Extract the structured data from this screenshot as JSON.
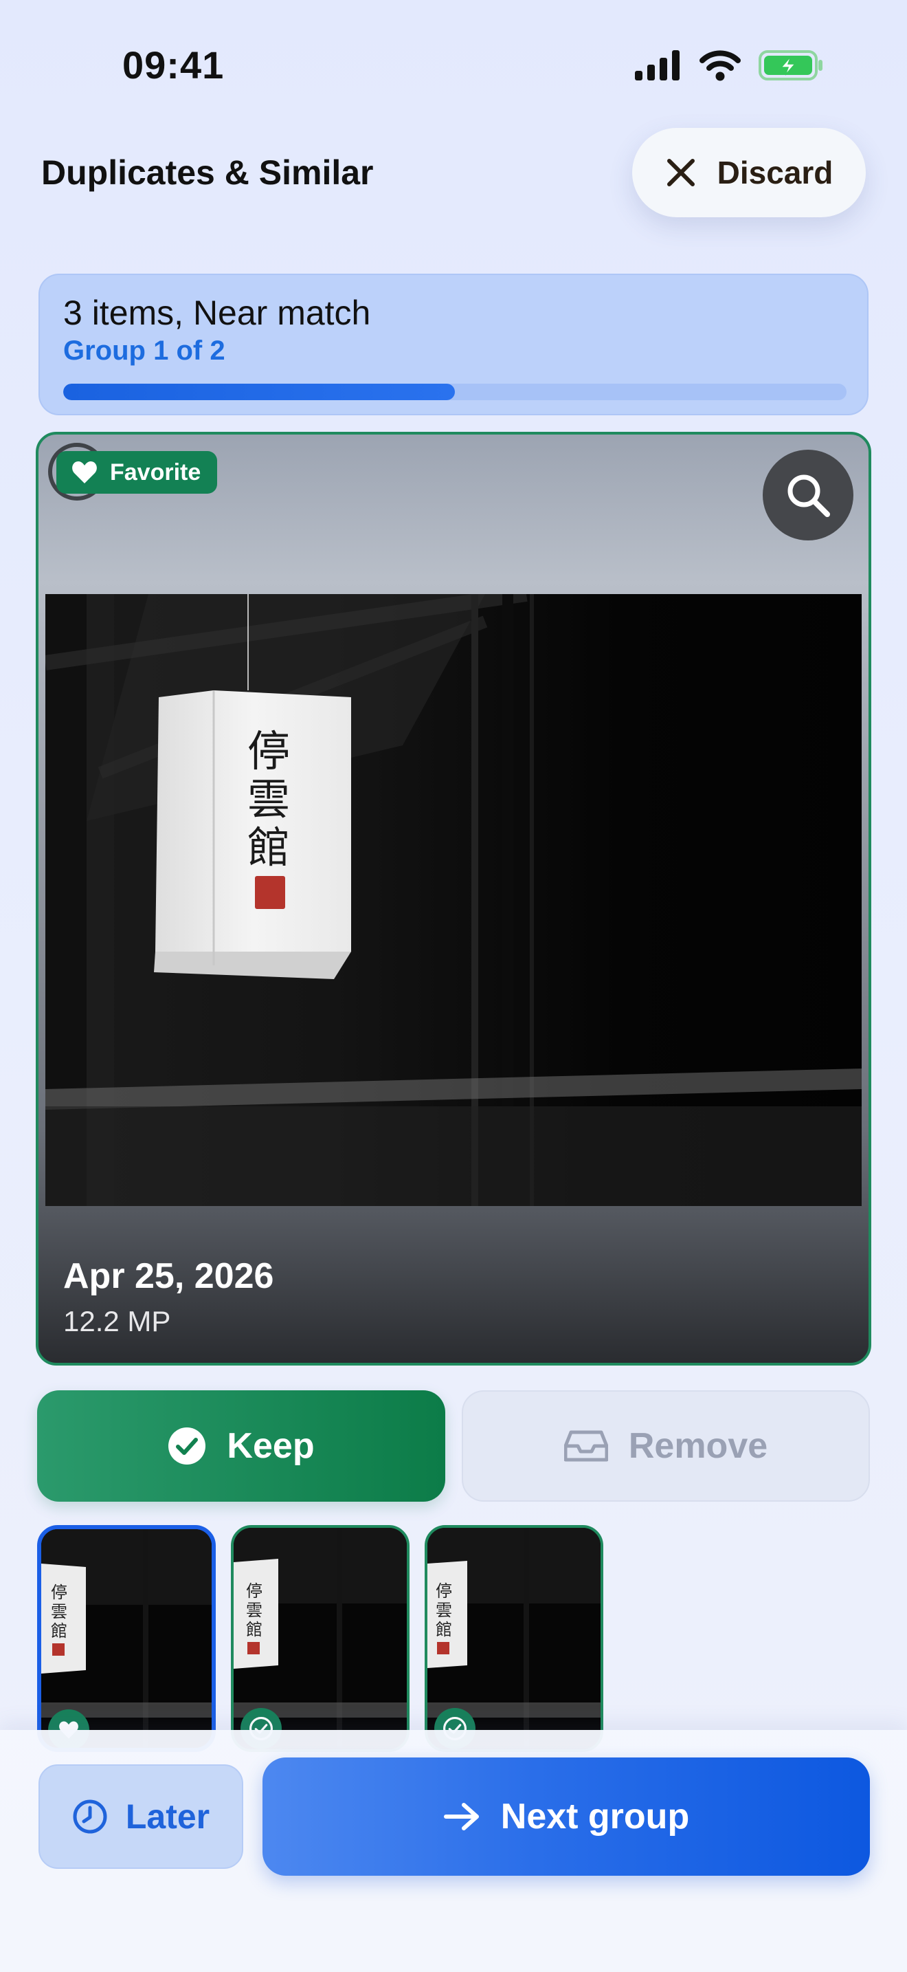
{
  "status_bar": {
    "time": "09:41",
    "icons": [
      "cellular-signal-icon",
      "wifi-icon",
      "battery-charging-icon"
    ],
    "battery_color": "#34c759"
  },
  "header": {
    "title": "Duplicates & Similar",
    "discard_label": "Discard",
    "discard_icon": "close-icon"
  },
  "group": {
    "summary": "3 items, Near match",
    "position_label": "Group 1 of 2",
    "progress_fraction": 0.5
  },
  "photo": {
    "badge_label": "Favorite",
    "badge_icon": "heart-icon",
    "zoom_icon": "search-icon",
    "date": "Apr 25, 2026",
    "resolution": "12.2 MP",
    "border_color": "#1f8a5e"
  },
  "actions": {
    "keep_label": "Keep",
    "keep_icon": "check-circle-icon",
    "remove_label": "Remove",
    "remove_icon": "tray-icon"
  },
  "thumbnails": [
    {
      "selected": true,
      "badge_icon": "heart-icon"
    },
    {
      "selected": false,
      "badge_icon": "check-circle-icon"
    },
    {
      "selected": false,
      "badge_icon": "check-circle-icon"
    }
  ],
  "footer": {
    "later_label": "Later",
    "later_icon": "clock-icon",
    "next_label": "Next group",
    "next_icon": "arrow-right-icon"
  },
  "colors": {
    "accent_blue": "#1d6cdf",
    "keep_green": "#0c7c48",
    "card_blue": "#bcd1fa"
  }
}
